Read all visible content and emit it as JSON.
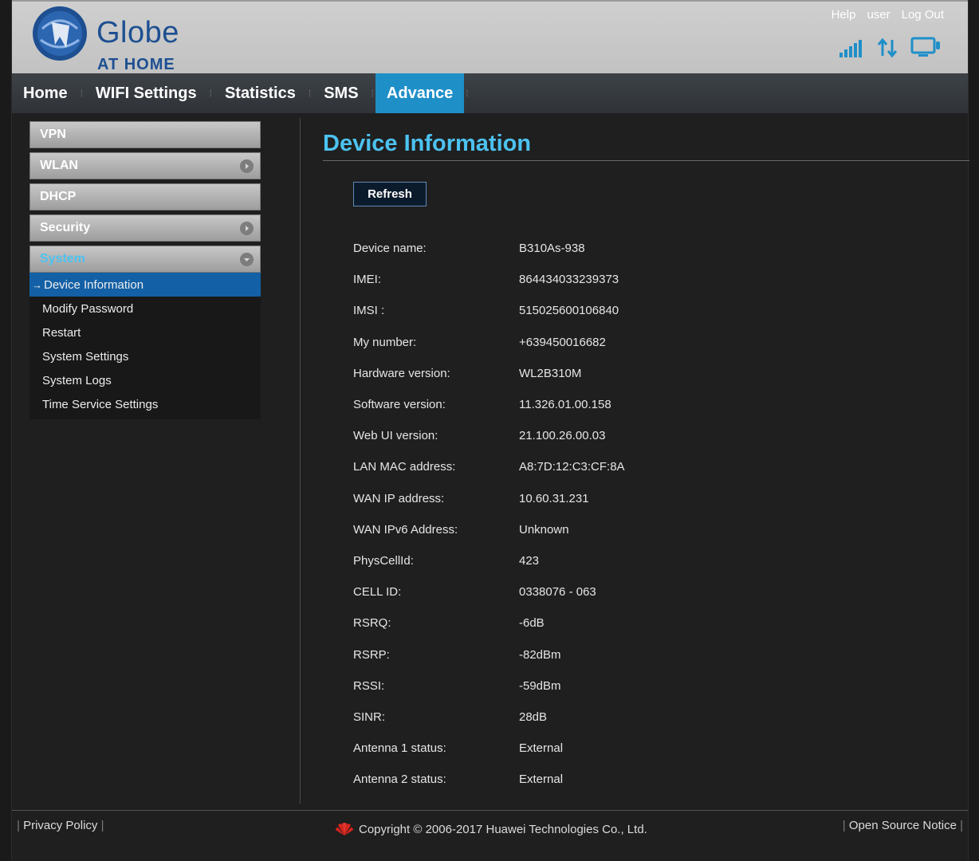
{
  "header": {
    "brand_name": "Globe",
    "brand_sub": "AT HOME",
    "links": {
      "help": "Help",
      "user": "user",
      "logout": "Log Out"
    },
    "icons": [
      "signal-strength-icon",
      "data-transfer-icon",
      "monitor-icon"
    ]
  },
  "nav": {
    "items": [
      {
        "label": "Home"
      },
      {
        "label": "WIFI Settings"
      },
      {
        "label": "Statistics"
      },
      {
        "label": "SMS"
      },
      {
        "label": "Advance",
        "active": true
      }
    ]
  },
  "sidebar": {
    "sections": [
      {
        "label": "VPN"
      },
      {
        "label": "WLAN"
      },
      {
        "label": "DHCP"
      },
      {
        "label": "Security"
      },
      {
        "label": "System",
        "open": true
      }
    ],
    "submenu": [
      {
        "label": "Device Information",
        "active": true
      },
      {
        "label": "Modify Password"
      },
      {
        "label": "Restart"
      },
      {
        "label": "System Settings"
      },
      {
        "label": "System Logs"
      },
      {
        "label": "Time Service Settings"
      }
    ]
  },
  "main": {
    "title": "Device Information",
    "refresh_label": "Refresh",
    "rows": [
      {
        "label": "Device name:",
        "value": "B310As-938"
      },
      {
        "label": "IMEI:",
        "value": "864434033239373"
      },
      {
        "label": "IMSI :",
        "value": "515025600106840"
      },
      {
        "label": "My number:",
        "value": "+639450016682"
      },
      {
        "label": "Hardware version:",
        "value": "WL2B310M"
      },
      {
        "label": "Software version:",
        "value": "11.326.01.00.158"
      },
      {
        "label": "Web UI version:",
        "value": "21.100.26.00.03"
      },
      {
        "label": "LAN MAC address:",
        "value": "A8:7D:12:C3:CF:8A"
      },
      {
        "label": "WAN IP address:",
        "value": "10.60.31.231"
      },
      {
        "label": "WAN IPv6 Address:",
        "value": "Unknown"
      },
      {
        "label": "PhysCellId:",
        "value": "423"
      },
      {
        "label": "CELL ID:",
        "value": "0338076 - 063"
      },
      {
        "label": "RSRQ:",
        "value": "-6dB"
      },
      {
        "label": "RSRP:",
        "value": "-82dBm"
      },
      {
        "label": "RSSI:",
        "value": "-59dBm"
      },
      {
        "label": "SINR:",
        "value": "28dB"
      },
      {
        "label": "Antenna 1 status:",
        "value": "External"
      },
      {
        "label": "Antenna 2 status:",
        "value": "External"
      }
    ]
  },
  "footer": {
    "privacy": "Privacy Policy",
    "copyright": "Copyright © 2006-2017 Huawei Technologies Co., Ltd.",
    "open_source": "Open Source Notice"
  },
  "colors": {
    "accent": "#4cc2f0",
    "nav_active": "#1f8fc8",
    "submenu_active": "#1360a6",
    "brand": "#1d4f91"
  }
}
